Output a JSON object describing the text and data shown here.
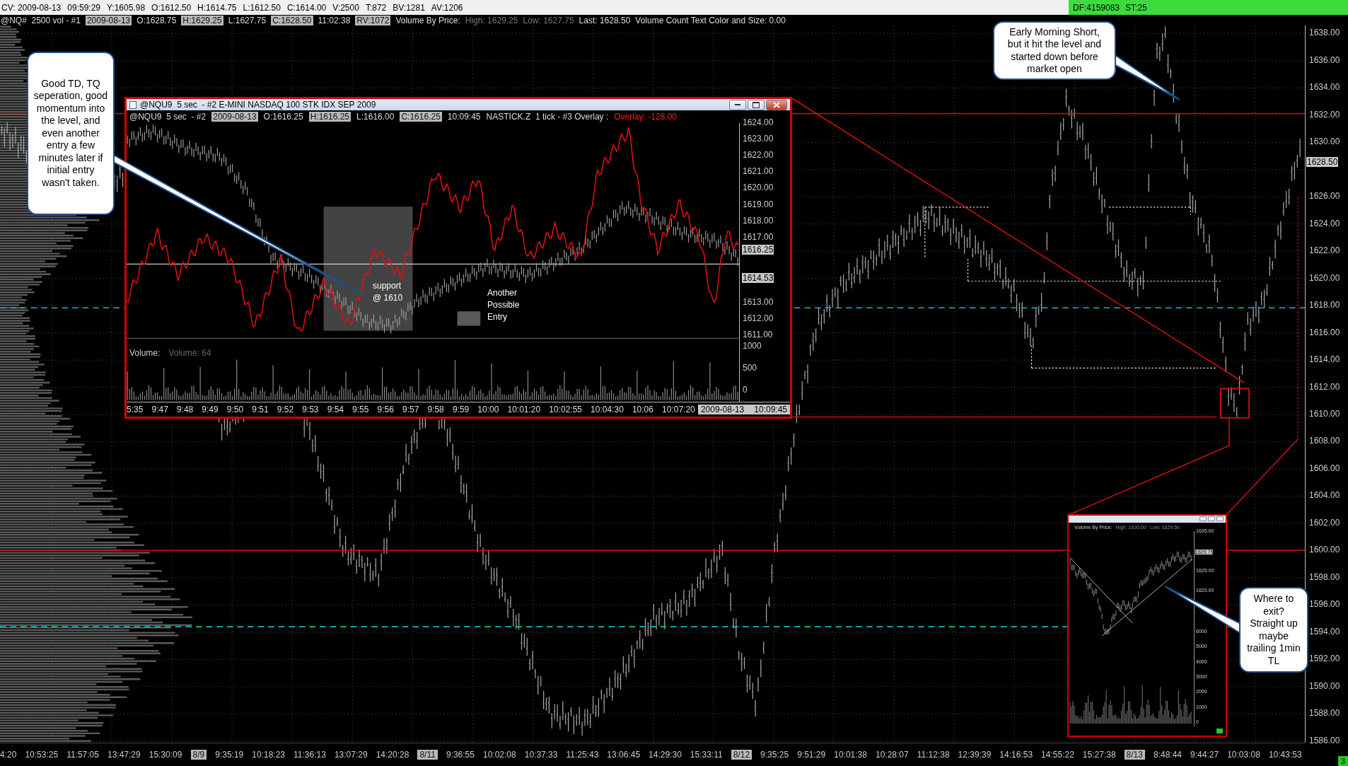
{
  "status_bar": {
    "items": [
      "CV: 2009-08-13",
      "09:59:29",
      "Y:1605.98",
      "O:1612.50",
      "H:1614.75",
      "L:1612.50",
      "C:1614.00",
      "V:2500",
      "T:872",
      "BV:1281",
      "AV:1206"
    ],
    "feed": [
      "DF:4159083",
      "ST:25"
    ]
  },
  "chart_header": [
    {
      "text": "@NQ#  2500 vol - #1",
      "kind": "plain"
    },
    {
      "text": "2009-08-13",
      "kind": "boxed"
    },
    {
      "text": "O:1628.75",
      "kind": "plain"
    },
    {
      "text": "H:1629.25",
      "kind": "boxed"
    },
    {
      "text": "L:1627.75",
      "kind": "plain"
    },
    {
      "text": "C:1628.50",
      "kind": "boxed"
    },
    {
      "text": "11:02:38",
      "kind": "plain"
    },
    {
      "text": "RV:1072",
      "kind": "boxed"
    },
    {
      "text": "Volume By Price:",
      "kind": "plain"
    },
    {
      "text": "High: 1629.25",
      "kind": "muted"
    },
    {
      "text": "Low: 1627.75",
      "kind": "muted"
    },
    {
      "text": "Last: 1628.50",
      "kind": "plain"
    },
    {
      "text": "Volume Count Text Color and Size: 0.00",
      "kind": "plain"
    }
  ],
  "price_axis": {
    "labels": [
      "1638.00",
      "1636.00",
      "1634.00",
      "1632.00",
      "1630.00",
      "1626.00",
      "1624.00",
      "1622.00",
      "1620.00",
      "1618.00",
      "1616.00",
      "1614.00",
      "1612.00",
      "1610.00",
      "1608.00",
      "1606.00",
      "1604.00",
      "1602.00",
      "1600.00",
      "1598.00",
      "1596.00",
      "1594.00",
      "1592.00",
      "1590.00",
      "1588.00",
      "1586.00"
    ],
    "last_price": "1628.50"
  },
  "time_axis": [
    {
      "text": "4:20",
      "kind": "time"
    },
    {
      "text": "10:53:25",
      "kind": "time"
    },
    {
      "text": "11:57:05",
      "kind": "time"
    },
    {
      "text": "13:47:29",
      "kind": "time"
    },
    {
      "text": "15:30:09",
      "kind": "time"
    },
    {
      "text": "8/9",
      "kind": "date"
    },
    {
      "text": "9:35:19",
      "kind": "time"
    },
    {
      "text": "10:18:23",
      "kind": "time"
    },
    {
      "text": "11:36:13",
      "kind": "time"
    },
    {
      "text": "13:07:29",
      "kind": "time"
    },
    {
      "text": "14:20:28",
      "kind": "time"
    },
    {
      "text": "8/11",
      "kind": "date"
    },
    {
      "text": "9:36:55",
      "kind": "time"
    },
    {
      "text": "10:02:08",
      "kind": "time"
    },
    {
      "text": "10:37:33",
      "kind": "time"
    },
    {
      "text": "11:25:43",
      "kind": "time"
    },
    {
      "text": "13:06:45",
      "kind": "time"
    },
    {
      "text": "14:29:30",
      "kind": "time"
    },
    {
      "text": "15:33:11",
      "kind": "time"
    },
    {
      "text": "8/12",
      "kind": "date"
    },
    {
      "text": "9:35:25",
      "kind": "time"
    },
    {
      "text": "9:51:29",
      "kind": "time"
    },
    {
      "text": "10:01:38",
      "kind": "time"
    },
    {
      "text": "10:28:07",
      "kind": "time"
    },
    {
      "text": "11:12:38",
      "kind": "time"
    },
    {
      "text": "12:39:39",
      "kind": "time"
    },
    {
      "text": "14:16:53",
      "kind": "time"
    },
    {
      "text": "14:55:22",
      "kind": "time"
    },
    {
      "text": "15:27:38",
      "kind": "time"
    },
    {
      "text": "8/13",
      "kind": "date"
    },
    {
      "text": "8:48:44",
      "kind": "time"
    },
    {
      "text": "9:44:27",
      "kind": "time"
    },
    {
      "text": "10:03:08",
      "kind": "time"
    },
    {
      "text": "10:43:53",
      "kind": "time"
    }
  ],
  "corner_badge": "3",
  "detail_window": {
    "title": "@NQU9  5 sec  - #2 E-MINI NASDAQ 100 STK IDX SEP 2009",
    "header": [
      {
        "text": "@NQU9  5 sec  - #2",
        "kind": "plain"
      },
      {
        "text": "2009-08-13",
        "kind": "boxed"
      },
      {
        "text": "O:1616.25",
        "kind": "plain"
      },
      {
        "text": "H:1616.25",
        "kind": "boxed"
      },
      {
        "text": "L:1616.00",
        "kind": "plain"
      },
      {
        "text": "C:1616.25",
        "kind": "boxed"
      },
      {
        "text": "10:09:45",
        "kind": "plain"
      },
      {
        "text": "NASTICK.Z  1 tick - #3 Overlay :",
        "kind": "plain"
      },
      {
        "text": "Overlay: -128.00",
        "kind": "alert"
      }
    ],
    "price_axis": [
      "1624.00",
      "1623.00",
      "1622.00",
      "1621.00",
      "1620.00",
      "1619.00",
      "1618.00",
      "1617.00",
      "1613.00",
      "1612.00",
      "1611.00"
    ],
    "price_markers": [
      "1616.25",
      "1614.53"
    ],
    "volume_axis": [
      "1000",
      "500",
      "0"
    ],
    "volume_label": "Volume:",
    "volume_value": "Volume: 64",
    "time_axis": [
      "5:35",
      "9:47",
      "9:48",
      "9:49",
      "9:50",
      "9:51",
      "9:52",
      "9:53",
      "9:54",
      "9:55",
      "9:56",
      "9:57",
      "9:58",
      "9:59",
      "10:00",
      "10:01:20",
      "10:02:55",
      "10:04:30",
      "10:06",
      "10:07:20"
    ],
    "time_stamp": [
      "2009-08-13",
      "10:09:45"
    ],
    "notes": [
      "support @ 1610",
      "Another Possible Entry"
    ]
  },
  "callouts": [
    "Good TD, TQ seperation, good momentum into the level, and even another entry a few minutes later if initial entry wasn't taken.",
    "Early Morning Short, but it hit the level and started down before market open",
    "Where to exit? Straight up maybe trailing 1min TL"
  ],
  "inset_window": {
    "header": [
      "Volume By Price:",
      "High: 1630.00",
      "Low: 1629.50"
    ],
    "price_axis": [
      "1635.00",
      "1625.00",
      "1620.00"
    ],
    "last_price": "1629.75",
    "volume_axis": [
      "6000",
      "5000",
      "4000",
      "3000",
      "2000",
      "1000",
      "0"
    ]
  }
}
